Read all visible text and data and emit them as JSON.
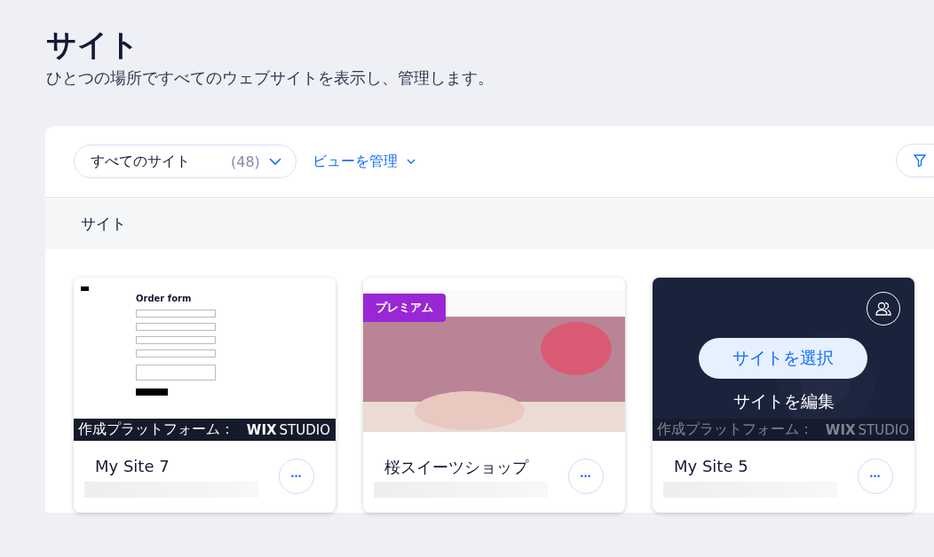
{
  "page": {
    "title": "サイト",
    "subtitle": "ひとつの場所ですべてのウェブサイトを表示し、管理します。"
  },
  "toolbar": {
    "view_filter": {
      "label": "すべてのサイト",
      "count": "(48)"
    },
    "manage_views": "ビューを管理"
  },
  "section_header": "サイト",
  "hover_actions": {
    "primary": "サイトを選択",
    "secondary": "サイトを編集"
  },
  "sites": [
    {
      "name": "My Site 7",
      "kind": "form",
      "preview_heading": "Order form",
      "built_with": {
        "label": "作成プラットフォーム：",
        "logo_bold": "WIX",
        "logo_light": "STUDIO"
      },
      "hovered": false
    },
    {
      "name": "桜スイーツショップ",
      "kind": "photo",
      "premium_label": "プレミアム",
      "hovered": false
    },
    {
      "name": "My Site 5",
      "kind": "dark",
      "built_with": {
        "label": "作成プラットフォーム：",
        "logo_bold": "WIX",
        "logo_light": "STUDIO"
      },
      "hovered": true
    }
  ],
  "more_button": "•••"
}
